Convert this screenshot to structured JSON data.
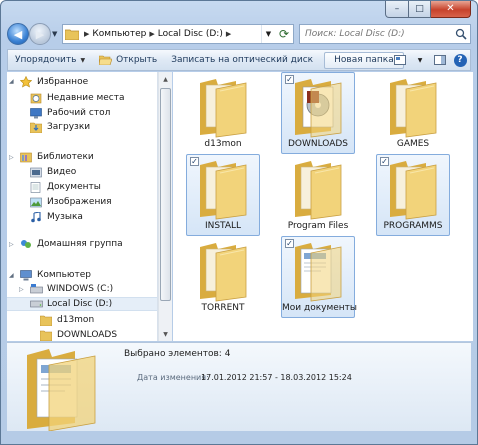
{
  "window": {
    "caption": {
      "minimize": "–",
      "maximize": "□",
      "close": "✕"
    }
  },
  "address": {
    "crumbs": [
      "Компьютер",
      "Local Disc (D:)"
    ],
    "search_placeholder": "Поиск: Local Disc (D:)"
  },
  "toolbar": {
    "organize": "Упорядочить",
    "open": "Открыть",
    "burn": "Записать на оптический диск",
    "new_folder": "Новая папка"
  },
  "sidebar": {
    "favorites": "Избранное",
    "fav_items": [
      "Недавние места",
      "Рабочий стол",
      "Загрузки"
    ],
    "libraries": "Библиотеки",
    "lib_items": [
      "Видео",
      "Документы",
      "Изображения",
      "Музыка"
    ],
    "homegroup": "Домашняя группа",
    "computer": "Компьютер",
    "drives": [
      "WINDOWS (C:)",
      "Local Disc (D:)"
    ],
    "subfolders": [
      "d13mon",
      "DOWNLOADS"
    ]
  },
  "files": [
    {
      "name": "d13mon",
      "selected": false,
      "overlay": "none"
    },
    {
      "name": "DOWNLOADS",
      "selected": true,
      "overlay": "media"
    },
    {
      "name": "GAMES",
      "selected": false,
      "overlay": "none"
    },
    {
      "name": "INSTALL",
      "selected": true,
      "overlay": "none"
    },
    {
      "name": "Program Files",
      "selected": false,
      "overlay": "none"
    },
    {
      "name": "PROGRAMMS",
      "selected": true,
      "overlay": "none"
    },
    {
      "name": "TORRENT",
      "selected": false,
      "overlay": "none"
    },
    {
      "name": "Мои документы",
      "selected": true,
      "overlay": "document"
    }
  ],
  "details": {
    "selected": "Выбрано элементов: 4",
    "date_label": "Дата изменения:",
    "date_value": "17.01.2012 21:57 - 18.03.2012 15:24"
  },
  "colors": {
    "folder": "#f2d37a",
    "folder_dark": "#d9ac3f",
    "selection": "#d5e5f7",
    "selection_border": "#84acdd"
  }
}
